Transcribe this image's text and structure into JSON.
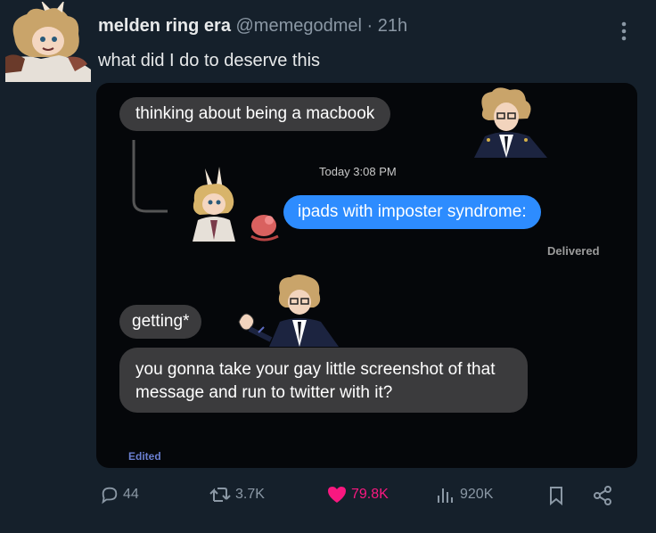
{
  "tweet": {
    "display_name": "melden ring era",
    "handle": "@memegodmel",
    "separator": "·",
    "time_ago": "21h",
    "text": "what did I do to deserve this"
  },
  "screenshot": {
    "messages": {
      "thinking": "thinking about being a macbook",
      "timestamp": "Today 3:08 PM",
      "ipads": "ipads with imposter syndrome:",
      "delivered": "Delivered",
      "getting": "getting*",
      "gonna": "you gonna take your gay little screenshot of that message and run to twitter with it?",
      "edited": "Edited"
    }
  },
  "actions": {
    "replies": "44",
    "retweets": "3.7K",
    "likes": "79.8K",
    "views": "920K"
  },
  "colors": {
    "background": "#15202b",
    "like_pink": "#f91880",
    "imessage_blue": "#2d8cff",
    "received_gray": "#3b3b3d",
    "muted_text": "#8b98a5"
  },
  "icons": [
    "more-vertical-icon",
    "reply-icon",
    "retweet-icon",
    "heart-icon",
    "views-icon",
    "bookmark-icon",
    "share-icon"
  ]
}
